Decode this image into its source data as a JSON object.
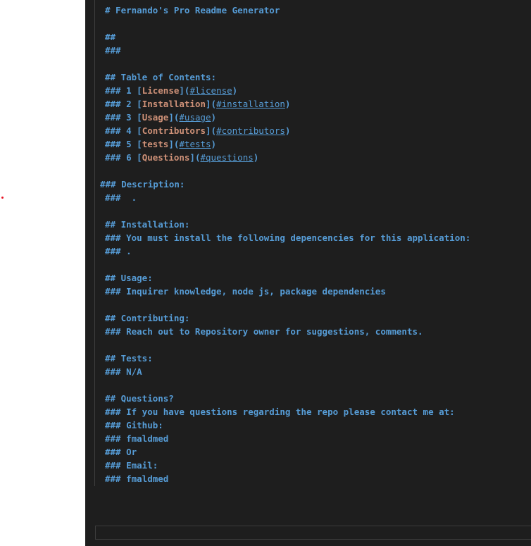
{
  "editor": {
    "lines": [
      {
        "text": "# Fernando's Pro Readme Generator"
      },
      {
        "text": ""
      },
      {
        "text": "##"
      },
      {
        "text": "###"
      },
      {
        "text": ""
      },
      {
        "text": "## Table of Contents:"
      },
      {
        "prefix": "### 1 ",
        "link_text": "License",
        "link_url": "#license"
      },
      {
        "prefix": "### 2 ",
        "link_text": "Installation",
        "link_url": "#installation"
      },
      {
        "prefix": "### 3 ",
        "link_text": "Usage",
        "link_url": "#usage"
      },
      {
        "prefix": "### 4 ",
        "link_text": "Contributors",
        "link_url": "#contributors"
      },
      {
        "prefix": "### 5 ",
        "link_text": "tests",
        "link_url": "#tests"
      },
      {
        "prefix": "### 6 ",
        "link_text": "Questions",
        "link_url": "#questions"
      },
      {
        "text": ""
      },
      {
        "text": "### Description:"
      },
      {
        "text": "###  ."
      },
      {
        "text": ""
      },
      {
        "text": "## Installation:"
      },
      {
        "text": "### You must install the following depencencies for this application:"
      },
      {
        "text": "### ."
      },
      {
        "text": ""
      },
      {
        "text": "## Usage:"
      },
      {
        "text": "### Inquirer knowledge, node js, package dependencies"
      },
      {
        "text": ""
      },
      {
        "text": "## Contributing:"
      },
      {
        "text": "### Reach out to Repository owner for suggestions, comments."
      },
      {
        "text": ""
      },
      {
        "text": "## Tests:"
      },
      {
        "text": "### N/A"
      },
      {
        "text": ""
      },
      {
        "text": "## Questions?"
      },
      {
        "text": "### If you have questions regarding the repo please contact me at:"
      },
      {
        "text": "### Github:"
      },
      {
        "text": "### fmaldmed"
      },
      {
        "text": "### Or"
      },
      {
        "text": "### Email:"
      },
      {
        "text": "### fmaldmed"
      }
    ]
  },
  "colors": {
    "editor_background": "#1e1e1e",
    "heading": "#569cd6",
    "link_text": "#ce9178",
    "page_background": "#ffffff",
    "marker_dot": "#e81123"
  }
}
